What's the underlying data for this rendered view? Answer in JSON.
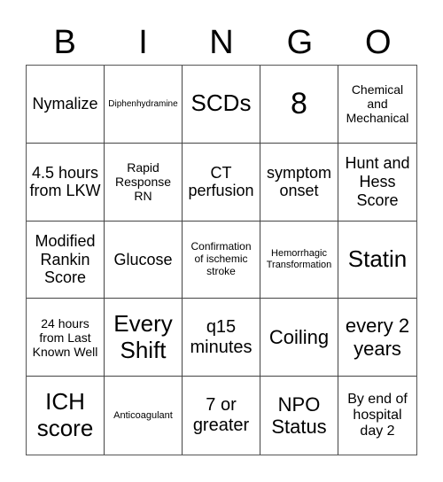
{
  "header": {
    "letters": [
      "B",
      "I",
      "N",
      "G",
      "O"
    ]
  },
  "board": {
    "rows": [
      [
        "Nymalize",
        "Diphenhydramine",
        "SCDs",
        "8",
        "Chemical and Mechanical"
      ],
      [
        "4.5 hours from LKW",
        "Rapid Response RN",
        "CT perfusion",
        "symptom onset",
        "Hunt and Hess Score"
      ],
      [
        "Modified Rankin Score",
        "Glucose",
        "Confirmation of ischemic stroke",
        "Hemorrhagic Transformation",
        "Statin"
      ],
      [
        "24 hours from Last Known Well",
        "Every Shift",
        "q15 minutes",
        "Coiling",
        "every 2 years"
      ],
      [
        "ICH score",
        "Anticoagulant",
        "7 or greater",
        "NPO Status",
        "By end of hospital day 2"
      ]
    ]
  }
}
